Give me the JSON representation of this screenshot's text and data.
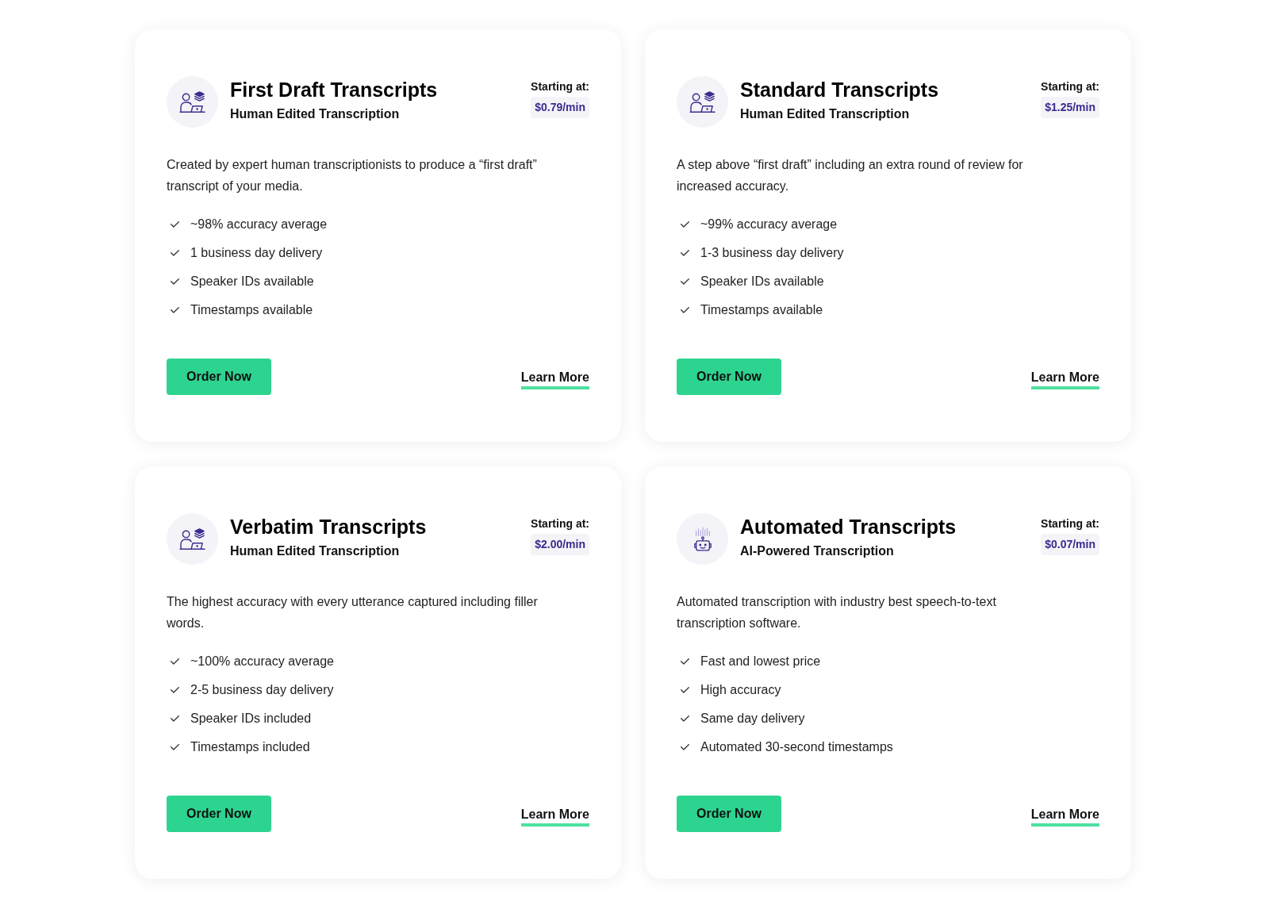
{
  "plans": [
    {
      "kind": "human",
      "title": "First Draft Transcripts",
      "subtitle": "Human Edited Transcription",
      "price_label": "Starting at:",
      "price": "$0.79/min",
      "description": "Created by expert human transcriptionists to produce a “first draft” transcript of your media.",
      "features": [
        "~98% accuracy average",
        "1 business day delivery",
        "Speaker IDs available",
        "Timestamps available"
      ],
      "order_button": "Order Now",
      "learn_more": "Learn More"
    },
    {
      "kind": "human",
      "title": "Standard Transcripts",
      "subtitle": "Human Edited Transcription",
      "price_label": "Starting at:",
      "price": "$1.25/min",
      "description": "A step above “first draft” including an extra round of review for increased accuracy.",
      "features": [
        "~99% accuracy average",
        "1-3 business day delivery",
        "Speaker IDs available",
        "Timestamps available"
      ],
      "order_button": "Order Now",
      "learn_more": "Learn More"
    },
    {
      "kind": "human",
      "title": "Verbatim Transcripts",
      "subtitle": "Human Edited Transcription",
      "price_label": "Starting at:",
      "price": "$2.00/min",
      "description": "The highest accuracy with every utterance captured including filler words.",
      "features": [
        "~100% accuracy average",
        "2-5 business day delivery",
        "Speaker IDs included",
        "Timestamps included"
      ],
      "order_button": "Order Now",
      "learn_more": "Learn More"
    },
    {
      "kind": "ai",
      "title": "Automated Transcripts",
      "subtitle": "AI-Powered Transcription",
      "price_label": "Starting at:",
      "price": "$0.07/min",
      "description": "Automated transcription with industry best speech-to-text transcription software.",
      "features": [
        "Fast and lowest price",
        "High accuracy",
        "Same day delivery",
        "Automated 30-second timestamps"
      ],
      "order_button": "Order Now",
      "learn_more": "Learn More"
    }
  ]
}
